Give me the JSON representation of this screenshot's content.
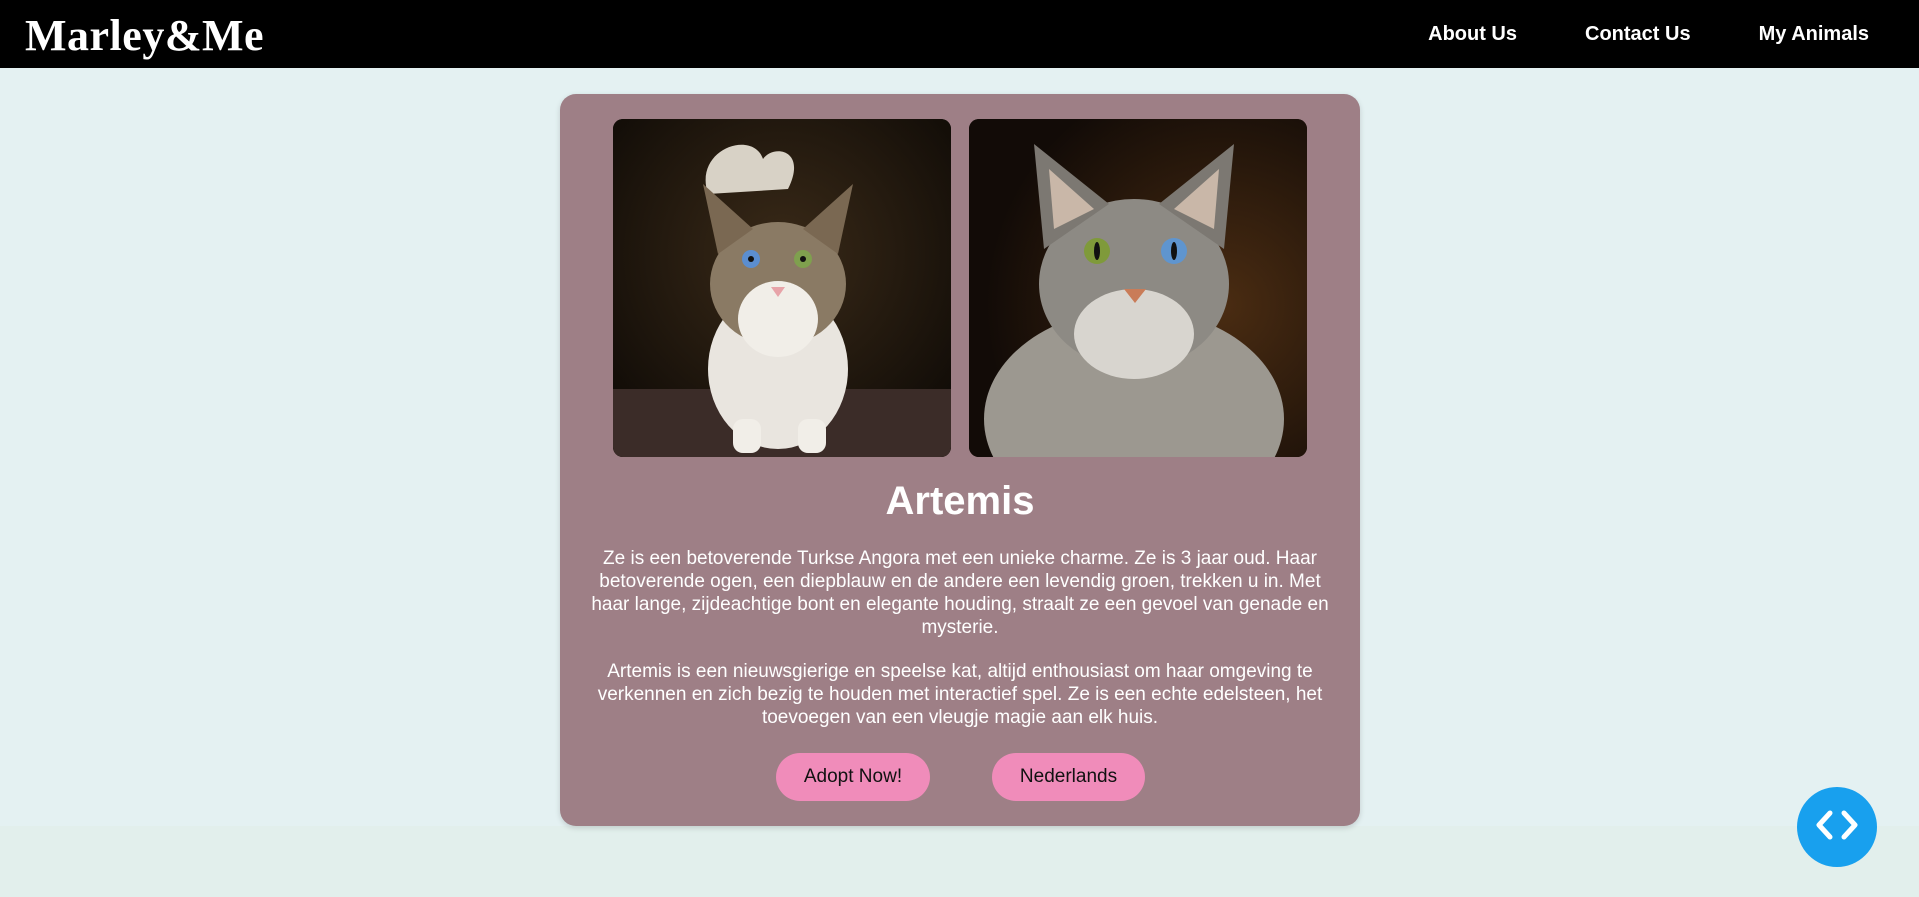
{
  "brand": {
    "name": "Marley&Me"
  },
  "nav": {
    "items": [
      "About Us",
      "Contact Us",
      "My Animals"
    ]
  },
  "pet": {
    "name": "Artemis",
    "photos": [
      "cat-photo-walking",
      "cat-photo-sitting"
    ],
    "description": [
      "Ze is een betoverende Turkse Angora met een unieke charme. Ze is 3 jaar oud. Haar betoverende ogen, een diepblauw en de andere een levendig groen, trekken u in. Met haar lange, zijdeachtige bont en elegante houding, straalt ze een gevoel van genade en mysterie.",
      "Artemis is een nieuwsgierige en speelse kat, altijd enthousiast om haar omgeving te verkennen en zich bezig te houden met interactief spel. Ze is een echte edelsteen, het toevoegen van een vleugje magie aan elk huis."
    ]
  },
  "actions": {
    "adopt_label": "Adopt Now!",
    "language_label": "Nederlands"
  },
  "fab": {
    "icon": "code-icon"
  },
  "colors": {
    "nav_bg": "#000000",
    "page_bg": "#e4f1f2",
    "card_bg": "#9e7f86",
    "button_bg": "#f08cba",
    "fab_bg": "#18a0ee"
  }
}
